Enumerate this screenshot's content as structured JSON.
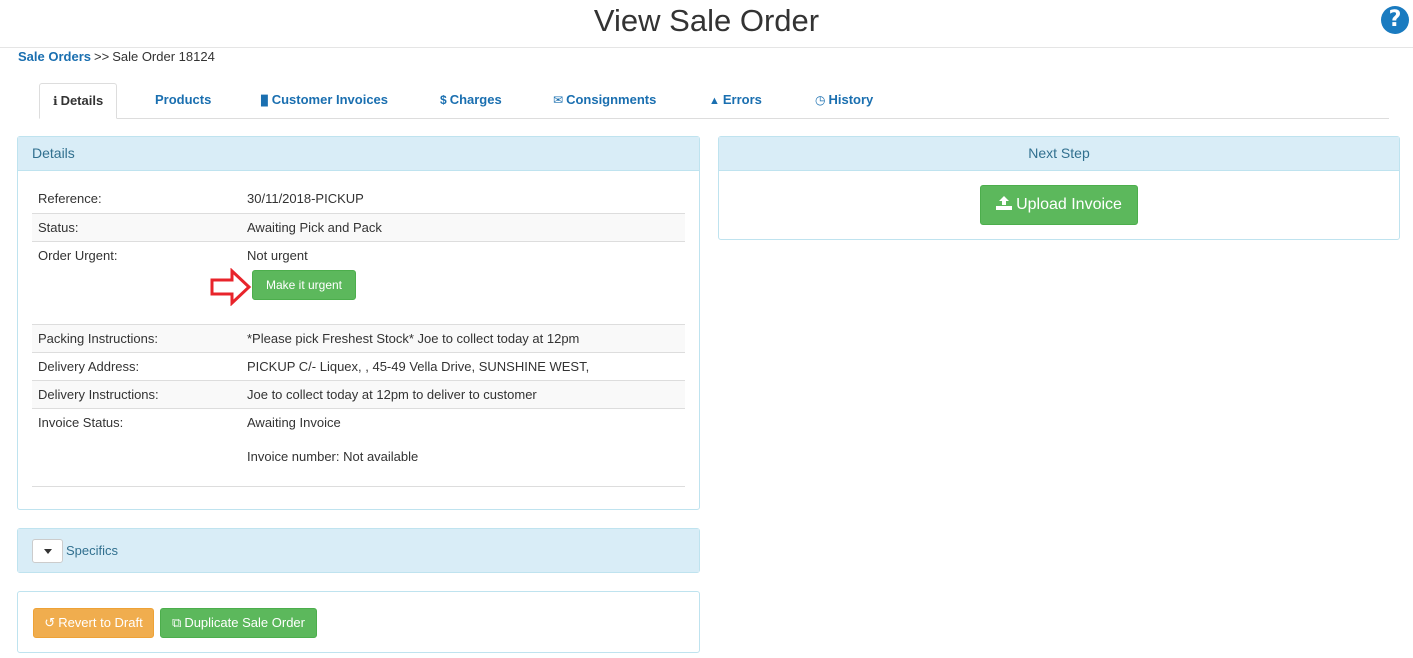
{
  "header": {
    "title": "View Sale Order",
    "help_glyph": "?"
  },
  "breadcrumb": {
    "root": "Sale Orders",
    "separator": ">>",
    "current": "Sale Order 18124"
  },
  "tabs": [
    {
      "label": "Details",
      "icon": "info-icon",
      "glyph": "ℹ"
    },
    {
      "label": "Products",
      "icon": "",
      "glyph": ""
    },
    {
      "label": "Customer Invoices",
      "icon": "file-icon",
      "glyph": "▉"
    },
    {
      "label": "Charges",
      "icon": "dollar-icon",
      "glyph": "$"
    },
    {
      "label": "Consignments",
      "icon": "envelope-icon",
      "glyph": "✉"
    },
    {
      "label": "Errors",
      "icon": "warning-icon",
      "glyph": "▲"
    },
    {
      "label": "History",
      "icon": "clock-icon",
      "glyph": "◷"
    }
  ],
  "details": {
    "heading": "Details",
    "rows": [
      {
        "label": "Reference:",
        "value": "30/11/2018-PICKUP"
      },
      {
        "label": "Status:",
        "value": "Awaiting Pick and Pack"
      },
      {
        "label": "Order Urgent:",
        "value": "Not urgent"
      },
      {
        "label": "Packing Instructions:",
        "value": "*Please pick Freshest Stock* Joe to collect today at 12pm"
      },
      {
        "label": "Delivery Address:",
        "value": "PICKUP C/- Liquex, , 45-49 Vella Drive, SUNSHINE WEST,"
      },
      {
        "label": "Delivery Instructions:",
        "value": "Joe to collect today at 12pm to deliver to customer"
      },
      {
        "label": "Invoice Status:",
        "value": "Awaiting Invoice"
      }
    ],
    "invoice_number": "Invoice number: Not available",
    "make_urgent_label": "Make it urgent"
  },
  "next_step": {
    "heading": "Next Step",
    "upload_label": "Upload Invoice"
  },
  "specifics": {
    "label": "Specifics"
  },
  "actions": {
    "revert_label": "Revert to Draft",
    "duplicate_label": "Duplicate Sale Order"
  },
  "colors": {
    "link": "#1a6fb0",
    "success": "#5cb85c",
    "warning": "#f0ad4e",
    "panel_heading": "#d9edf7",
    "arrow": "#e8242b"
  }
}
